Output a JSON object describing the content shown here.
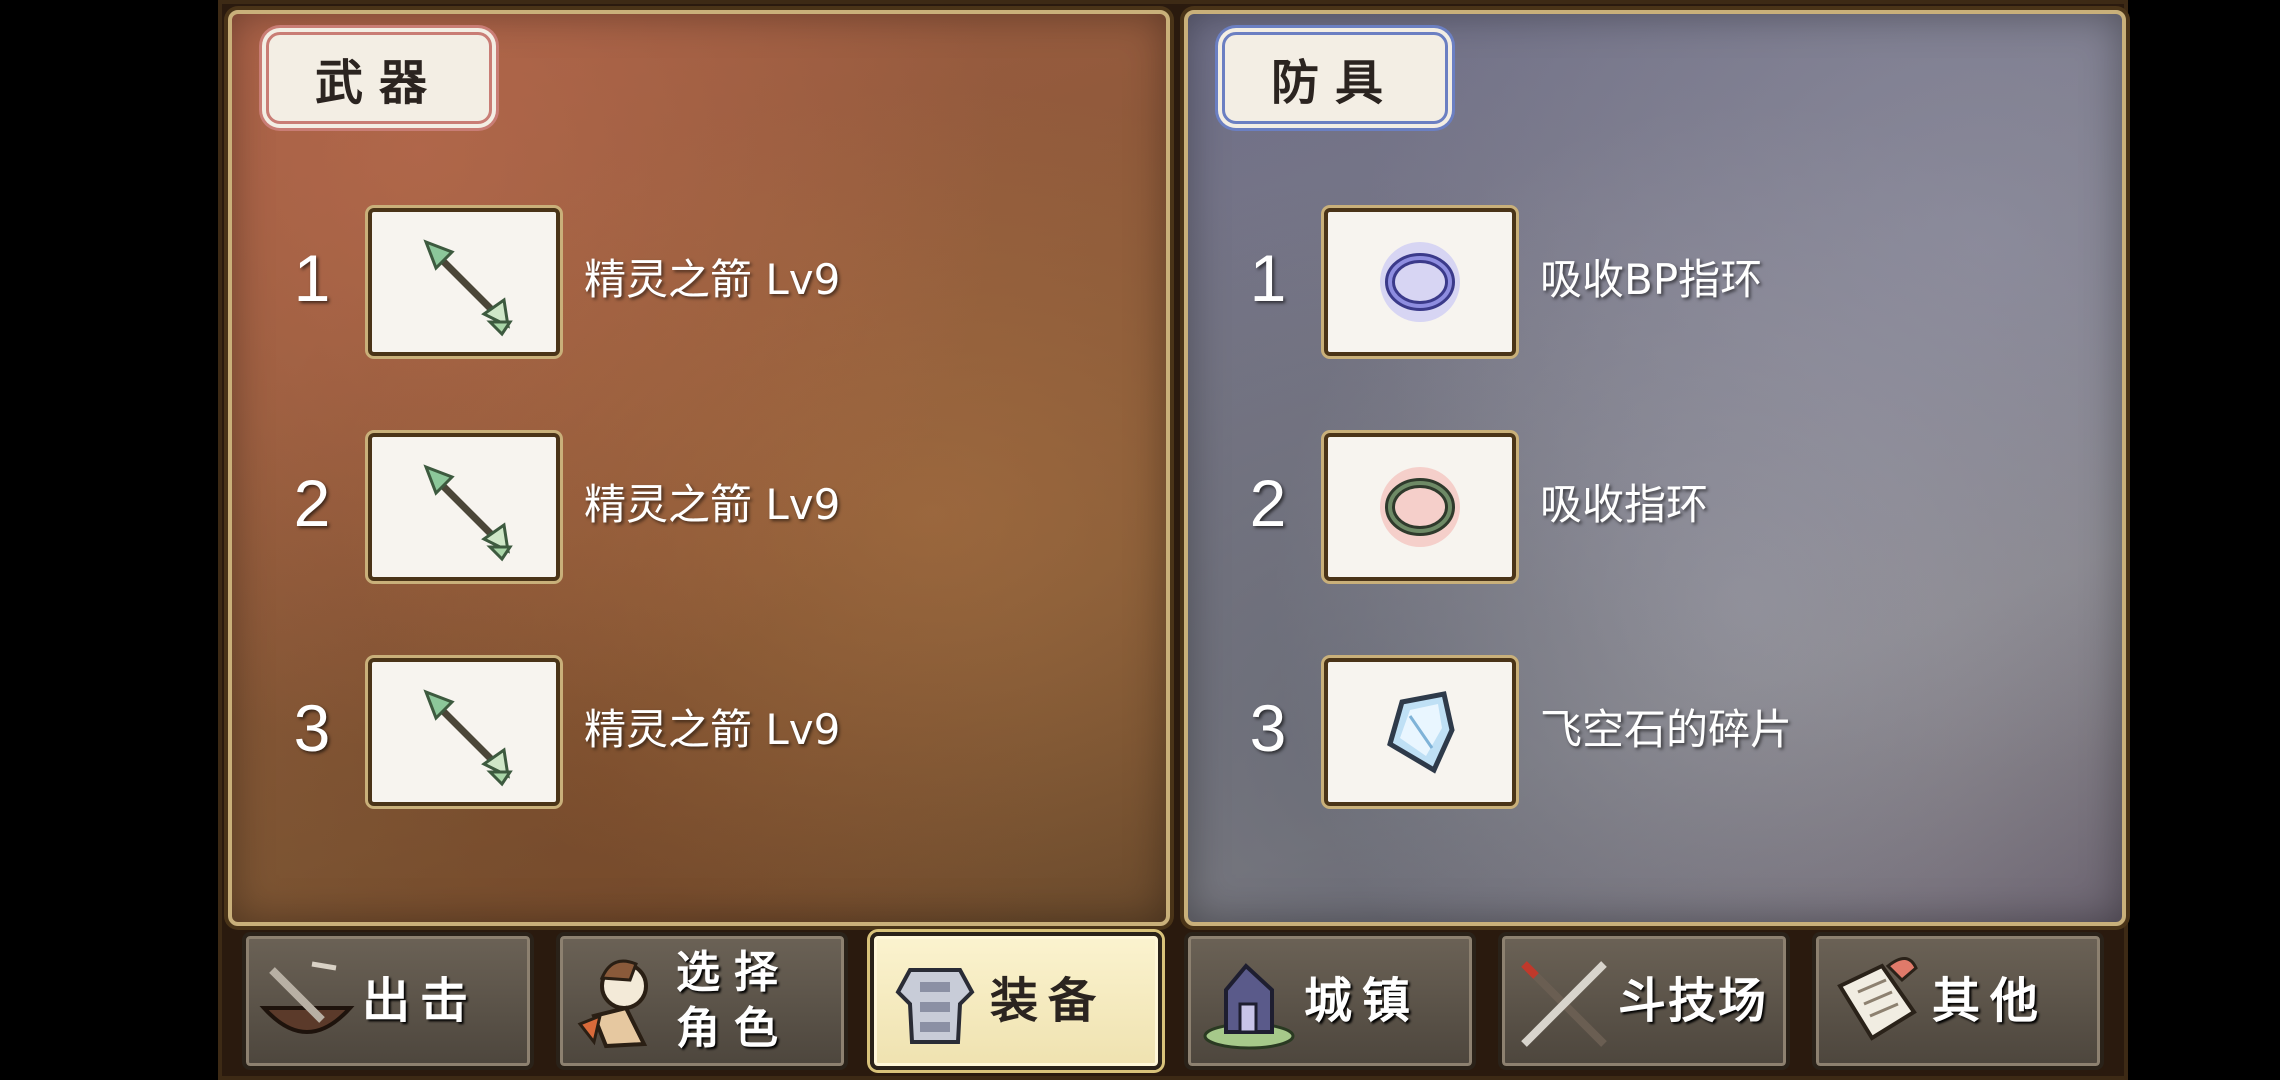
{
  "weapons": {
    "title": "武器",
    "slots": [
      {
        "num": "1",
        "name": "精灵之箭 Lv9",
        "icon": "elf-arrow-icon"
      },
      {
        "num": "2",
        "name": "精灵之箭 Lv9",
        "icon": "elf-arrow-icon"
      },
      {
        "num": "3",
        "name": "精灵之箭 Lv9",
        "icon": "elf-arrow-icon"
      }
    ]
  },
  "armor": {
    "title": "防具",
    "slots": [
      {
        "num": "1",
        "name": "吸收BP指环",
        "icon": "ring-blue-icon"
      },
      {
        "num": "2",
        "name": "吸收指环",
        "icon": "ring-red-icon"
      },
      {
        "num": "3",
        "name": "飞空石的碎片",
        "icon": "crystal-shard-icon"
      }
    ]
  },
  "nav": {
    "sortie": "出击",
    "select_line1": "选择",
    "select_line2": "角色",
    "equip": "装备",
    "town": "城镇",
    "arena": "斗技场",
    "other": "其他",
    "active": "equip"
  }
}
